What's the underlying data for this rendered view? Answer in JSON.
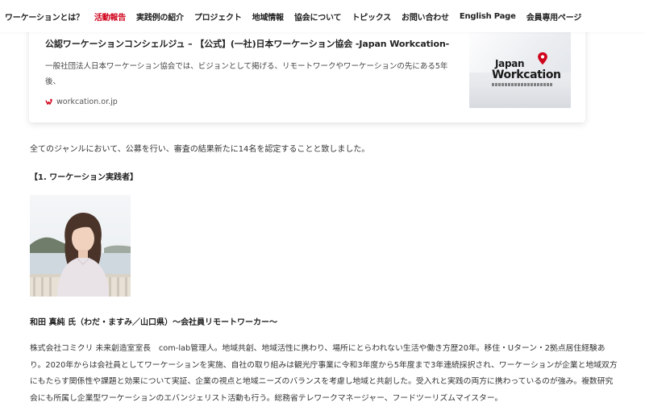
{
  "nav": {
    "items": [
      {
        "label": "ワーケーションとは？",
        "active": false
      },
      {
        "label": "活動報告",
        "active": true
      },
      {
        "label": "実践例の紹介",
        "active": false
      },
      {
        "label": "プロジェクト",
        "active": false
      },
      {
        "label": "地域情報",
        "active": false
      },
      {
        "label": "協会について",
        "active": false
      },
      {
        "label": "トピックス",
        "active": false
      },
      {
        "label": "お問い合わせ",
        "active": false
      },
      {
        "label": "English Page",
        "active": false
      },
      {
        "label": "会員専用ページ",
        "active": false
      }
    ],
    "accent_color": "#d0021b"
  },
  "embed_card": {
    "title": "公認ワーケーションコンシェルジュ – 【公式】(一社)日本ワーケーション協会 -Japan Workcation-",
    "description": "一般社団法人日本ワーケーション協会では、ビジョンとして掲げる、リモートワークやワーケーションの先にある5年後、",
    "site": "workcation.or.jp",
    "favicon_icon": "workcation-favicon-icon",
    "thumbnail": {
      "logo_line1": "Japan",
      "logo_line2": "Workcation"
    }
  },
  "content": {
    "intro": "全てのジャンルにおいて、公募を行い、審査の結果新たに14名を認定することと致しました。",
    "section_heading": "【1. ワーケーション実践者】",
    "person_name": "和田 真純 氏（わだ・ますみ／山口県）〜会社員リモートワーカー〜",
    "bio": "株式会社コミクリ 未来創造室室長　com-lab管理人。地域共創、地域活性に携わり、場所にとらわれない生活や働き方歴20年。移住・Uターン・2拠点居住経験あり。2020年からは会社員としてワーケーションを実施、自社の取り組みは観光庁事業に令和3年度から5年度まで3年連続採択され、ワーケーションが企業と地域双方にもたらす関係性や課題と効果について実証、企業の視点と地域ニーズのバランスを考慮し地域と共創した。受入れと実践の両方に携わっているのが強み。複数研究会にも所属し企業型ワーケーションのエバンジェリスト活動も行う。総務省テレワークマネージャー、フードツーリズムマイスター。"
  }
}
